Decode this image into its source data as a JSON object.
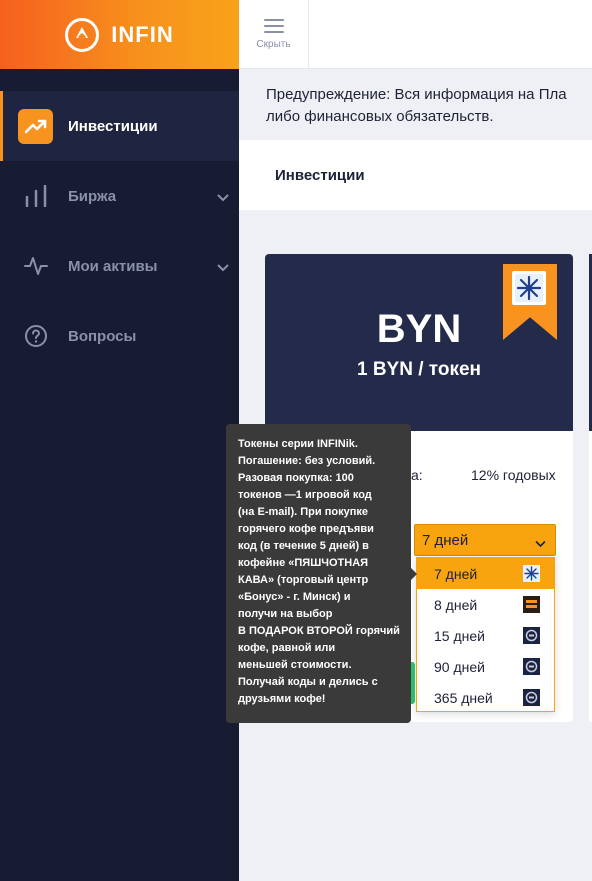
{
  "brand": {
    "name": "INFIN"
  },
  "header": {
    "hide_label": "Скрыть"
  },
  "sidebar": {
    "items": [
      {
        "label": "Инвестиции",
        "icon": "trending-up-icon",
        "active": true
      },
      {
        "label": "Биржа",
        "icon": "bar-chart-icon",
        "expandable": true
      },
      {
        "label": "Мои активы",
        "icon": "activity-icon",
        "expandable": true
      },
      {
        "label": "Вопросы",
        "icon": "question-icon"
      }
    ]
  },
  "warning": {
    "line1": "Предупреждение: Вся информация на Пла",
    "line2": "либо финансовых обязательств."
  },
  "breadcrumb": {
    "label": "Инвестиции"
  },
  "card": {
    "title": "BYN",
    "subtitle": "1 BYN / токен",
    "rate_label": "а:",
    "rate_value": "12% годовых"
  },
  "period_select": {
    "value": "7 дней",
    "options": [
      "7 дней",
      "8 дней",
      "15 дней",
      "90 дней",
      "365 дней"
    ]
  },
  "tooltip": {
    "lines": [
      "Токены серии INFINik.",
      "Погашение: без условий.",
      "Разовая покупка: 100",
      "токенов —1 игровой код",
      "(на E-mail). При покупке",
      "горячего кофе предъяви",
      "код (в течение 5 дней) в",
      "кофейне «ПЯШЧОТНАЯ",
      "КАВА» (торговый центр",
      "«Бонус» - г. Минск) и",
      "получи на выбор",
      "В ПОДАРОК ВТОРОЙ горячий",
      "кофе, равной или",
      "меньшей стоимости.",
      "Получай коды и делись с",
      "друзьями кофе!"
    ]
  },
  "colors": {
    "sidebar_bg": "#181c33",
    "accent": "#f7931e",
    "card_head": "#242a4a",
    "tooltip_bg": "#3a3a3a",
    "success": "#2fc46a"
  }
}
